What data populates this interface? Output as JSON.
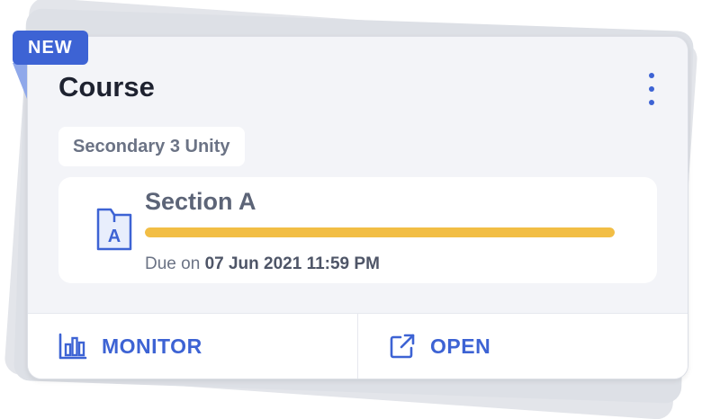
{
  "badge": {
    "label": "NEW"
  },
  "card": {
    "title": "Course",
    "class_name": "Secondary 3 Unity",
    "menu_icon": "more-vertical-icon"
  },
  "assignment": {
    "icon": "folder-letter-icon",
    "icon_letter": "A",
    "title": "Section A",
    "progress": 1.0,
    "due_prefix": "Due on",
    "due_date": "07 Jun 2021 11:59 PM"
  },
  "actions": {
    "monitor": {
      "label": "MONITOR",
      "icon": "bar-chart-icon"
    },
    "open": {
      "label": "OPEN",
      "icon": "external-link-icon"
    }
  },
  "colors": {
    "accent": "#3d63d4",
    "progress": "#f2be45",
    "card_bg": "#f3f4f8"
  }
}
